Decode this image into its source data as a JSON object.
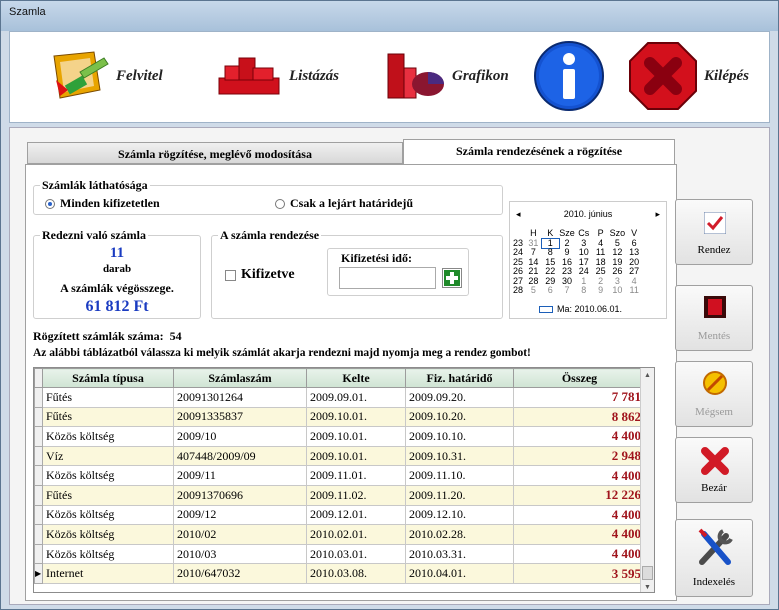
{
  "window": {
    "title": "Szamla"
  },
  "toolbar": {
    "felvitel": "Felvitel",
    "listazas": "Listázás",
    "grafikon": "Grafikon",
    "kilepes": "Kilépés"
  },
  "tabs": {
    "tab1": "Számla rögzítése, meglévő modosítása",
    "tab2": "Számla rendezésének a rögzítése"
  },
  "visibility": {
    "label": "Számlák láthatósága",
    "option1": "Minden kifizetetlen",
    "option2": "Csak a lejárt határidejű",
    "selected": "option1"
  },
  "to_settle": {
    "label": "Redezni való számla",
    "count": "11",
    "unit": "darab",
    "total_label": "A számlák végösszege.",
    "total": "61 812 Ft"
  },
  "settlement": {
    "label": "A számla rendezése",
    "checkbox_label": "Kifizetve",
    "date_label": "Kifizetési idő:",
    "date_value": ""
  },
  "calendar": {
    "month": "2010. június",
    "days": [
      "H",
      "K",
      "Sze",
      "Cs",
      "P",
      "Szo",
      "V"
    ],
    "weeks": [
      {
        "wk": "23",
        "d": [
          "31",
          "1",
          "2",
          "3",
          "4",
          "5",
          "6"
        ]
      },
      {
        "wk": "24",
        "d": [
          "7",
          "8",
          "9",
          "10",
          "11",
          "12",
          "13"
        ]
      },
      {
        "wk": "25",
        "d": [
          "14",
          "15",
          "16",
          "17",
          "18",
          "19",
          "20"
        ]
      },
      {
        "wk": "26",
        "d": [
          "21",
          "22",
          "23",
          "24",
          "25",
          "26",
          "27"
        ]
      },
      {
        "wk": "27",
        "d": [
          "28",
          "29",
          "30",
          "1",
          "2",
          "3",
          "4"
        ]
      },
      {
        "wk": "28",
        "d": [
          "5",
          "6",
          "7",
          "8",
          "9",
          "10",
          "11"
        ]
      }
    ],
    "today": "Ma: 2010.06.01.",
    "prev": "◂",
    "next": "▸"
  },
  "info": {
    "recorded_label": "Rögzített számlák száma:",
    "recorded_count": "54",
    "instruction": "Az alábbi táblázatból válassza ki melyik számlát akarja rendezni majd nyomja meg a rendez gombot!"
  },
  "table": {
    "headers": [
      "Számla típusa",
      "Számlaszám",
      "Kelte",
      "Fiz. határidő",
      "Összeg"
    ],
    "rows": [
      [
        "Fűtés",
        "20091301264",
        "2009.09.01.",
        "2009.09.20.",
        "7 781"
      ],
      [
        "Fűtés",
        "20091335837",
        "2009.10.01.",
        "2009.10.20.",
        "8 862"
      ],
      [
        "Közös költség",
        "2009/10",
        "2009.10.01.",
        "2009.10.10.",
        "4 400"
      ],
      [
        "Víz",
        "407448/2009/09",
        "2009.10.01.",
        "2009.10.31.",
        "2 948"
      ],
      [
        "Közös költség",
        "2009/11",
        "2009.11.01.",
        "2009.11.10.",
        "4 400"
      ],
      [
        "Fűtés",
        "20091370696",
        "2009.11.02.",
        "2009.11.20.",
        "12 226"
      ],
      [
        "Közös költség",
        "2009/12",
        "2009.12.01.",
        "2009.12.10.",
        "4 400"
      ],
      [
        "Közös költség",
        "2010/02",
        "2010.02.01.",
        "2010.02.28.",
        "4 400"
      ],
      [
        "Közös költség",
        "2010/03",
        "2010.03.01.",
        "2010.03.31.",
        "4 400"
      ],
      [
        "Internet",
        "2010/647032",
        "2010.03.08.",
        "2010.04.01.",
        "3 595"
      ]
    ],
    "current_row_marker": "▶"
  },
  "side_buttons": {
    "rendez": "Rendez",
    "mentes": "Mentés",
    "megsem": "Mégsem",
    "bezar": "Bezár",
    "indexeles": "Indexelés"
  }
}
